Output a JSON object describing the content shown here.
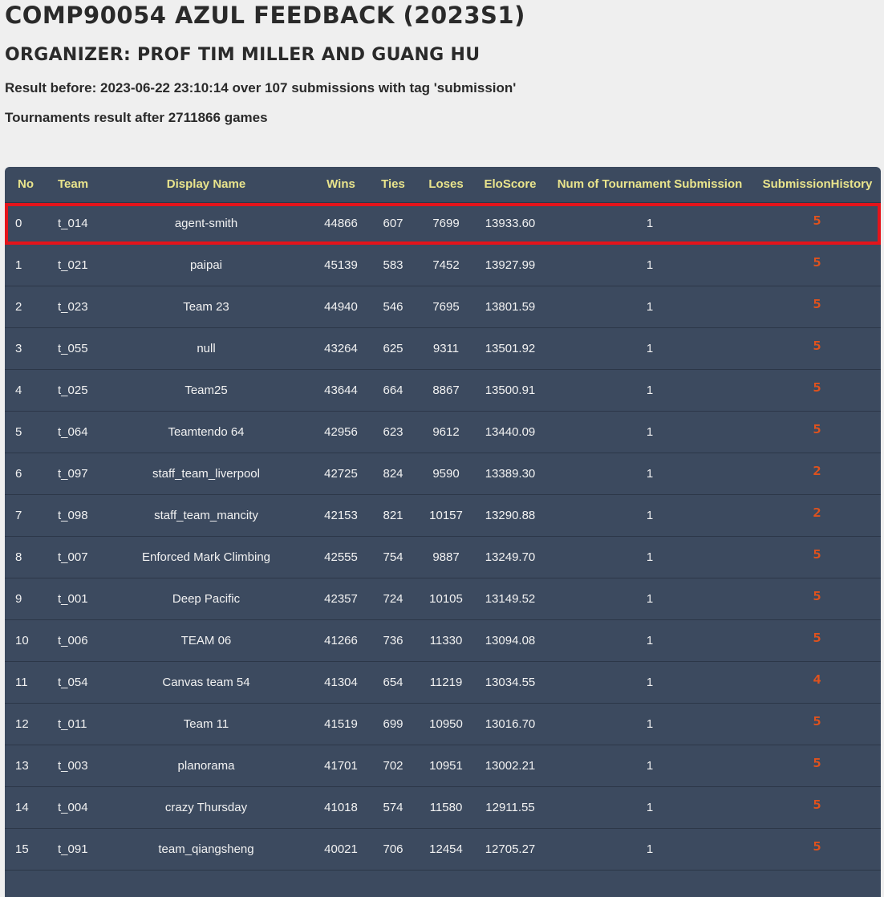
{
  "title": "COMP90054 AZUL FEEDBACK (2023S1)",
  "organizer": "ORGANIZER: PROF TIM MILLER AND GUANG HU",
  "result_line": "Result before: 2023-06-22 23:10:14 over 107 submissions with tag 'submission'",
  "tournament_line": "Tournaments result after 2711866 games",
  "colors": {
    "header_text": "#e9e48c",
    "table_bg": "#3c4a5f",
    "highlight": "#e4141b",
    "history_link": "#e0521d"
  },
  "table": {
    "headers": {
      "no": "No",
      "team": "Team",
      "display_name": "Display Name",
      "wins": "Wins",
      "ties": "Ties",
      "loses": "Loses",
      "elo": "EloScore",
      "num_submissions": "Num of Tournament Submission",
      "history": "SubmissionHistory"
    },
    "highlighted_row": 0,
    "rows": [
      {
        "no": "0",
        "team": "t_014",
        "display_name": "agent-smith",
        "wins": "44866",
        "ties": "607",
        "loses": "7699",
        "elo": "13933.60",
        "num": "1",
        "history": "5"
      },
      {
        "no": "1",
        "team": "t_021",
        "display_name": "paipai",
        "wins": "45139",
        "ties": "583",
        "loses": "7452",
        "elo": "13927.99",
        "num": "1",
        "history": "5"
      },
      {
        "no": "2",
        "team": "t_023",
        "display_name": "Team 23",
        "wins": "44940",
        "ties": "546",
        "loses": "7695",
        "elo": "13801.59",
        "num": "1",
        "history": "5"
      },
      {
        "no": "3",
        "team": "t_055",
        "display_name": "null",
        "wins": "43264",
        "ties": "625",
        "loses": "9311",
        "elo": "13501.92",
        "num": "1",
        "history": "5"
      },
      {
        "no": "4",
        "team": "t_025",
        "display_name": "Team25",
        "wins": "43644",
        "ties": "664",
        "loses": "8867",
        "elo": "13500.91",
        "num": "1",
        "history": "5"
      },
      {
        "no": "5",
        "team": "t_064",
        "display_name": "Teamtendo 64",
        "wins": "42956",
        "ties": "623",
        "loses": "9612",
        "elo": "13440.09",
        "num": "1",
        "history": "5"
      },
      {
        "no": "6",
        "team": "t_097",
        "display_name": "staff_team_liverpool",
        "wins": "42725",
        "ties": "824",
        "loses": "9590",
        "elo": "13389.30",
        "num": "1",
        "history": "2"
      },
      {
        "no": "7",
        "team": "t_098",
        "display_name": "staff_team_mancity",
        "wins": "42153",
        "ties": "821",
        "loses": "10157",
        "elo": "13290.88",
        "num": "1",
        "history": "2"
      },
      {
        "no": "8",
        "team": "t_007",
        "display_name": "Enforced Mark Climbing",
        "wins": "42555",
        "ties": "754",
        "loses": "9887",
        "elo": "13249.70",
        "num": "1",
        "history": "5"
      },
      {
        "no": "9",
        "team": "t_001",
        "display_name": "Deep Pacific",
        "wins": "42357",
        "ties": "724",
        "loses": "10105",
        "elo": "13149.52",
        "num": "1",
        "history": "5"
      },
      {
        "no": "10",
        "team": "t_006",
        "display_name": "TEAM 06",
        "wins": "41266",
        "ties": "736",
        "loses": "11330",
        "elo": "13094.08",
        "num": "1",
        "history": "5"
      },
      {
        "no": "11",
        "team": "t_054",
        "display_name": "Canvas team 54",
        "wins": "41304",
        "ties": "654",
        "loses": "11219",
        "elo": "13034.55",
        "num": "1",
        "history": "4"
      },
      {
        "no": "12",
        "team": "t_011",
        "display_name": "Team 11",
        "wins": "41519",
        "ties": "699",
        "loses": "10950",
        "elo": "13016.70",
        "num": "1",
        "history": "5"
      },
      {
        "no": "13",
        "team": "t_003",
        "display_name": "planorama",
        "wins": "41701",
        "ties": "702",
        "loses": "10951",
        "elo": "13002.21",
        "num": "1",
        "history": "5"
      },
      {
        "no": "14",
        "team": "t_004",
        "display_name": "crazy Thursday",
        "wins": "41018",
        "ties": "574",
        "loses": "11580",
        "elo": "12911.55",
        "num": "1",
        "history": "5"
      },
      {
        "no": "15",
        "team": "t_091",
        "display_name": "team_qiangsheng",
        "wins": "40021",
        "ties": "706",
        "loses": "12454",
        "elo": "12705.27",
        "num": "1",
        "history": "5"
      }
    ]
  }
}
